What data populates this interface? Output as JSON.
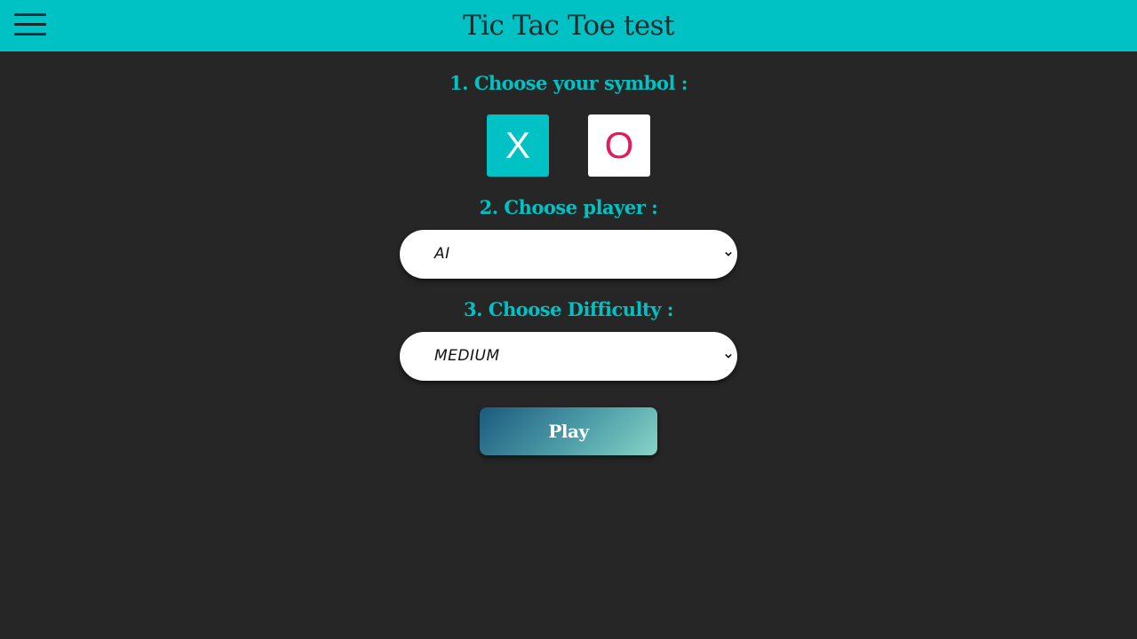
{
  "header": {
    "title": "Tic Tac Toe test",
    "menu_icon": "hamburger-menu-icon",
    "background": "#00c2c4"
  },
  "steps": {
    "symbol_label": "1. Choose your symbol :",
    "player_label": "2. Choose player :",
    "difficulty_label": "3. Choose Difficulty :"
  },
  "symbols": {
    "x": {
      "label": "X",
      "selected": true,
      "color": "#00c2c4"
    },
    "o": {
      "label": "O",
      "selected": false,
      "color": "#e6195c"
    }
  },
  "player_select": {
    "value": "AI"
  },
  "difficulty_select": {
    "value": "MEDIUM"
  },
  "play_button": {
    "label": "Play"
  },
  "colors": {
    "accent": "#00c2c4",
    "background": "#262626",
    "o_symbol": "#e6195c"
  }
}
